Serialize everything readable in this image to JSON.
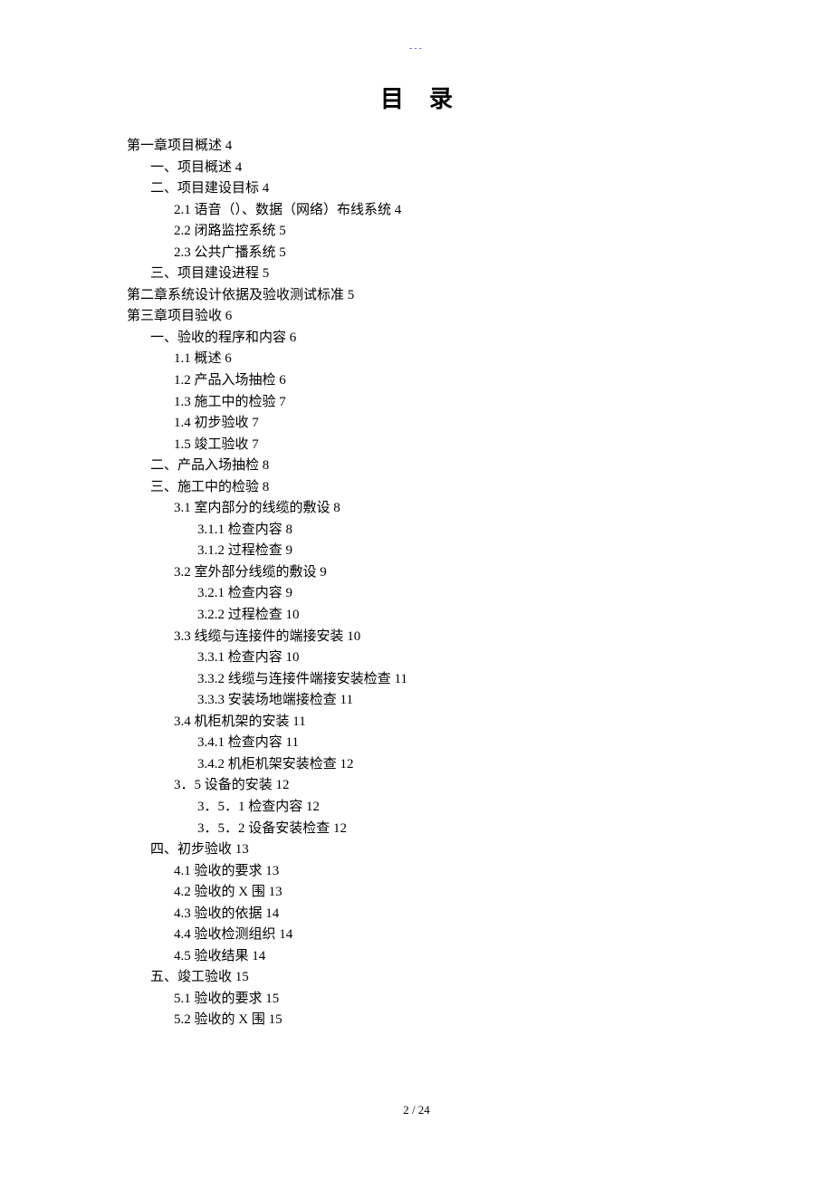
{
  "header_marker": "---",
  "title": "目录",
  "toc": [
    {
      "lv": 1,
      "t": "第一章项目概述 4"
    },
    {
      "lv": 2,
      "t": "一、项目概述 4"
    },
    {
      "lv": 2,
      "t": "二、项目建设目标 4"
    },
    {
      "lv": 3,
      "t": "2.1  语音（）、数据（网络）布线系统 4"
    },
    {
      "lv": 3,
      "t": "2.2  闭路监控系统 5"
    },
    {
      "lv": 3,
      "t": "2.3  公共广播系统 5"
    },
    {
      "lv": 2,
      "t": "三、项目建设进程 5"
    },
    {
      "lv": 1,
      "t": "第二章系统设计依据及验收测试标准 5"
    },
    {
      "lv": 1,
      "t": "第三章项目验收 6"
    },
    {
      "lv": 2,
      "t": "一、验收的程序和内容 6"
    },
    {
      "lv": 3,
      "t": "1.1  概述 6"
    },
    {
      "lv": 3,
      "t": "1.2  产品入场抽检 6"
    },
    {
      "lv": 3,
      "t": "1.3  施工中的检验 7"
    },
    {
      "lv": 3,
      "t": "1.4  初步验收 7"
    },
    {
      "lv": 3,
      "t": "1.5  竣工验收 7"
    },
    {
      "lv": 2,
      "t": "二、产品入场抽检 8"
    },
    {
      "lv": 2,
      "t": "三、施工中的检验 8"
    },
    {
      "lv": 3,
      "t": "3.1  室内部分的线缆的敷设 8"
    },
    {
      "lv": 4,
      "t": "3.1.1  检查内容 8"
    },
    {
      "lv": 4,
      "t": "3.1.2  过程检查 9"
    },
    {
      "lv": 3,
      "t": "3.2  室外部分线缆的敷设 9"
    },
    {
      "lv": 4,
      "t": "3.2.1  检查内容 9"
    },
    {
      "lv": 4,
      "t": "3.2.2  过程检查 10"
    },
    {
      "lv": 3,
      "t": "3.3  线缆与连接件的端接安装 10"
    },
    {
      "lv": 4,
      "t": "3.3.1  检查内容 10"
    },
    {
      "lv": 4,
      "t": "3.3.2  线缆与连接件端接安装检查 11"
    },
    {
      "lv": 4,
      "t": "3.3.3  安装场地端接检查 11"
    },
    {
      "lv": 3,
      "t": "3.4  机柜机架的安装 11"
    },
    {
      "lv": 4,
      "t": "3.4.1  检查内容 11"
    },
    {
      "lv": 4,
      "t": "3.4.2  机柜机架安装检查 12"
    },
    {
      "lv": 3,
      "t": "3．5  设备的安装 12"
    },
    {
      "lv": 4,
      "t": "3．5．1  检查内容 12"
    },
    {
      "lv": 4,
      "t": "3．5．2  设备安装检查 12"
    },
    {
      "lv": 2,
      "t": "四、初步验收 13"
    },
    {
      "lv": 3,
      "t": "4.1  验收的要求 13"
    },
    {
      "lv": 3,
      "t": "4.2  验收的 X 围 13"
    },
    {
      "lv": 3,
      "t": "4.3  验收的依据 14"
    },
    {
      "lv": 3,
      "t": "4.4  验收检测组织 14"
    },
    {
      "lv": 3,
      "t": "4.5  验收结果 14"
    },
    {
      "lv": 2,
      "t": "五、竣工验收 15"
    },
    {
      "lv": 3,
      "t": "5.1  验收的要求 15"
    },
    {
      "lv": 3,
      "t": "5.2  验收的 X 围 15"
    }
  ],
  "footer": "2  / 24"
}
